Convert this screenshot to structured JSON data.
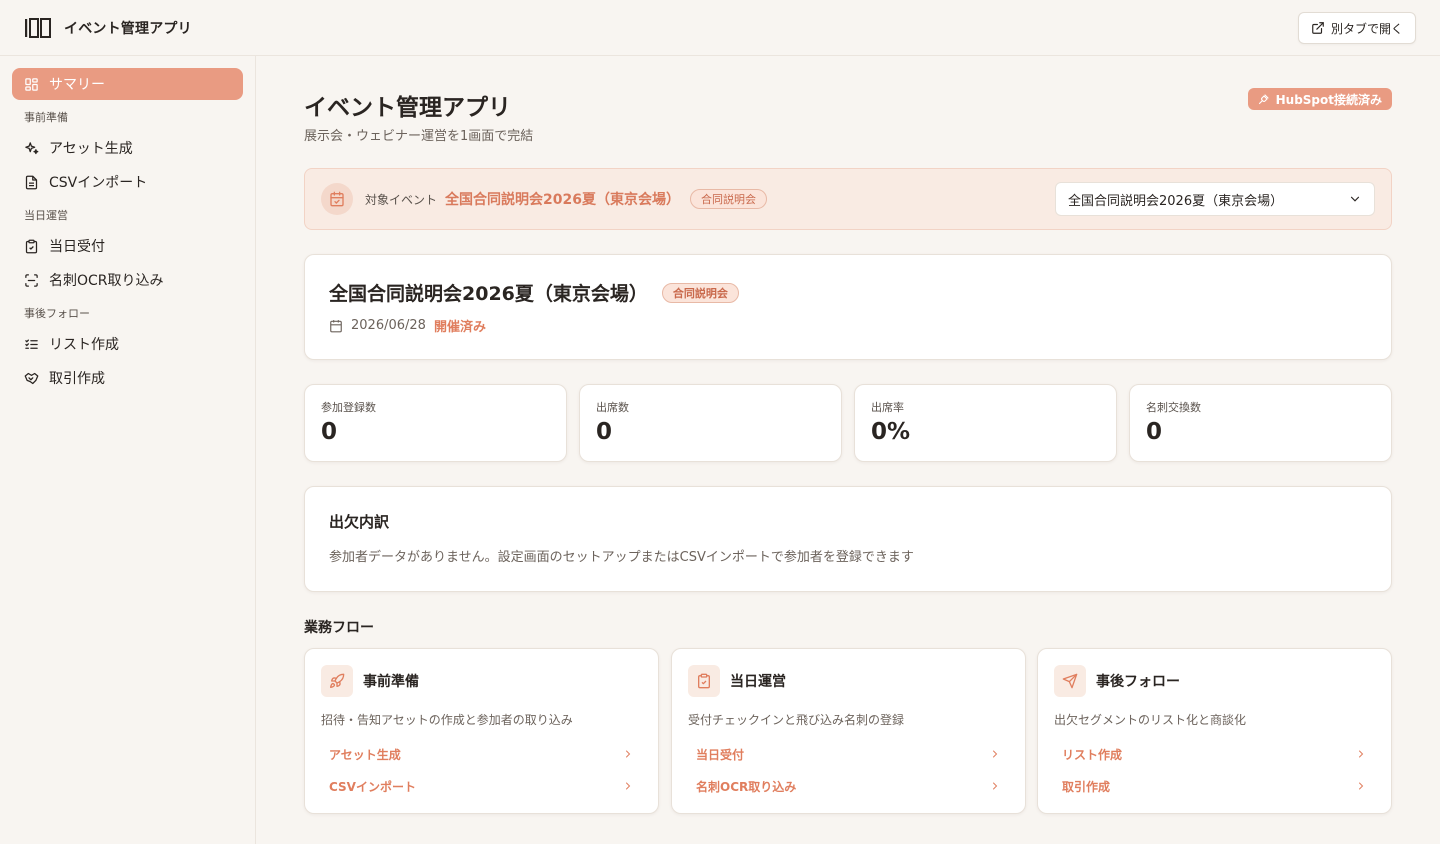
{
  "app": {
    "title": "イベント管理アプリ",
    "open_tab_label": "別タブで開く"
  },
  "sidebar": {
    "summary": "サマリー",
    "groups": [
      {
        "label": "事前準備",
        "items": [
          {
            "label": "アセット生成",
            "icon": "sparkles-icon"
          },
          {
            "label": "CSVインポート",
            "icon": "file-text-icon"
          }
        ]
      },
      {
        "label": "当日運営",
        "items": [
          {
            "label": "当日受付",
            "icon": "clipboard-check-icon"
          },
          {
            "label": "名刺OCR取り込み",
            "icon": "scan-icon"
          }
        ]
      },
      {
        "label": "事後フォロー",
        "items": [
          {
            "label": "リスト作成",
            "icon": "list-checks-icon"
          },
          {
            "label": "取引作成",
            "icon": "handshake-icon"
          }
        ]
      }
    ]
  },
  "header": {
    "title": "イベント管理アプリ",
    "subtitle": "展示会・ウェビナー運営を1画面で完結",
    "hubspot_badge": "HubSpot接続済み"
  },
  "target": {
    "label": "対象イベント",
    "event_name": "全国合同説明会2026夏（東京会場）",
    "tag": "合同説明会",
    "select_value": "全国合同説明会2026夏（東京会場）"
  },
  "event": {
    "title": "全国合同説明会2026夏（東京会場）",
    "tag": "合同説明会",
    "date": "2026/06/28",
    "status": "開催済み"
  },
  "stats": [
    {
      "label": "参加登録数",
      "value": "0"
    },
    {
      "label": "出席数",
      "value": "0"
    },
    {
      "label": "出席率",
      "value": "0%"
    },
    {
      "label": "名刺交換数",
      "value": "0"
    }
  ],
  "breakdown": {
    "title": "出欠内訳",
    "empty_text": "参加者データがありません。設定画面のセットアップまたはCSVインポートで参加者を登録できます"
  },
  "flow": {
    "title": "業務フロー",
    "cards": [
      {
        "name": "事前準備",
        "icon": "rocket-icon",
        "desc": "招待・告知アセットの作成と参加者の取り込み",
        "links": [
          "アセット生成",
          "CSVインポート"
        ]
      },
      {
        "name": "当日運営",
        "icon": "clipboard-check-icon",
        "desc": "受付チェックインと飛び込み名刺の登録",
        "links": [
          "当日受付",
          "名刺OCR取り込み"
        ]
      },
      {
        "name": "事後フォロー",
        "icon": "send-icon",
        "desc": "出欠セグメントのリスト化と商談化",
        "links": [
          "リスト作成",
          "取引作成"
        ]
      }
    ]
  },
  "colors": {
    "accent": "#e99b82",
    "accent_text": "#e07e5e",
    "background": "#f8f5f1"
  }
}
